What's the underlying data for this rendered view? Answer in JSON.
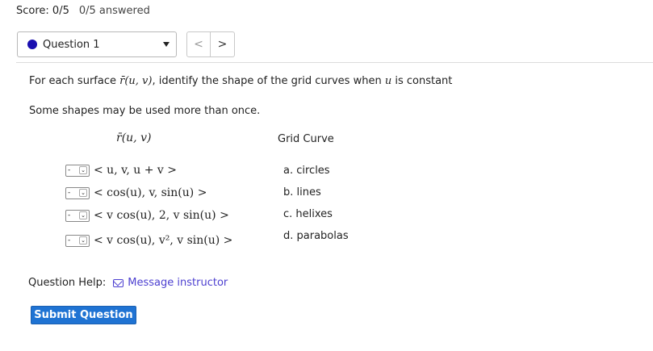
{
  "header": {
    "score_label": "Score: 0/5",
    "answered_label": "0/5 answered"
  },
  "question_select": {
    "selected": "Question 1",
    "prev_label": "<",
    "next_label": ">"
  },
  "question": {
    "prompt_prefix": "For each surface ",
    "prompt_math": "r̄(u, v)",
    "prompt_mid": ", identify the shape of the grid curves when ",
    "prompt_var": "u",
    "prompt_suffix": " is constant",
    "note": "Some shapes may be used more than once.",
    "left_header": "r̄(u, v)",
    "right_header": "Grid Curve",
    "rows": [
      {
        "selected": "-",
        "expr": "< u, v, u + v >"
      },
      {
        "selected": "-",
        "expr": "< cos(u), v, sin(u) >"
      },
      {
        "selected": "-",
        "expr": "< v cos(u), 2, v sin(u) >"
      },
      {
        "selected": "-",
        "expr": "< v cos(u), v², v sin(u) >"
      }
    ],
    "options": [
      "a. circles",
      "b. lines",
      "c. helixes",
      "d. parabolas"
    ]
  },
  "help": {
    "label": "Question Help:",
    "link": "Message instructor"
  },
  "submit_label": "Submit Question",
  "colors": {
    "accent": "#1f73d3",
    "link": "#4c3fd0",
    "question_dot": "#1a0fb0"
  }
}
